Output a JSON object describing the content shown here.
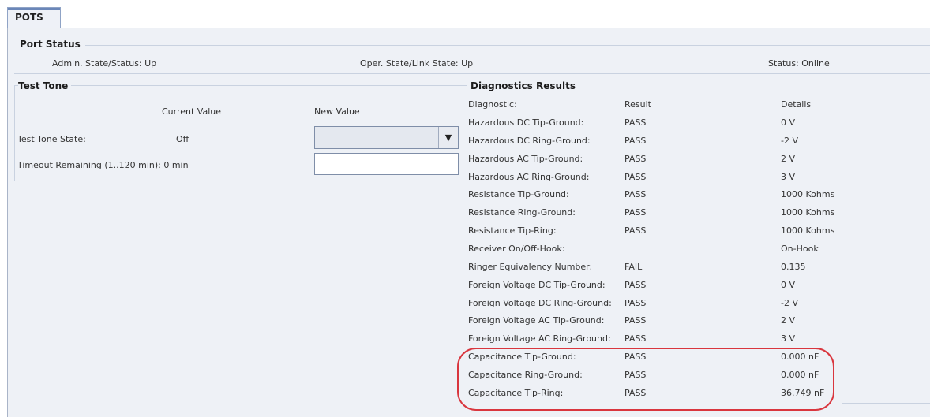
{
  "tab": {
    "label": "POTS"
  },
  "port_status": {
    "title": "Port Status",
    "admin_state": "Admin. State/Status: Up",
    "oper_state": "Oper. State/Link State: Up",
    "status": "Status: Online"
  },
  "test_tone": {
    "title": "Test Tone",
    "current_value_header": "Current Value",
    "new_value_header": "New Value",
    "state_label": "Test Tone State:",
    "state_value": "Off",
    "state_new_value": "",
    "timeout_label": "Timeout Remaining (1..120 min): 0 min",
    "timeout_new_value": ""
  },
  "diagnostics": {
    "title": "Diagnostics Results",
    "headers": {
      "diagnostic": "Diagnostic:",
      "result": "Result",
      "details": "Details"
    },
    "rows": [
      {
        "name": "Hazardous DC Tip-Ground:",
        "result": "PASS",
        "details": "0 V"
      },
      {
        "name": "Hazardous DC Ring-Ground:",
        "result": "PASS",
        "details": "-2 V"
      },
      {
        "name": "Hazardous AC Tip-Ground:",
        "result": "PASS",
        "details": "2 V"
      },
      {
        "name": "Hazardous AC Ring-Ground:",
        "result": "PASS",
        "details": "3 V"
      },
      {
        "name": "Resistance Tip-Ground:",
        "result": "PASS",
        "details": "1000 Kohms"
      },
      {
        "name": "Resistance Ring-Ground:",
        "result": "PASS",
        "details": "1000 Kohms"
      },
      {
        "name": "Resistance Tip-Ring:",
        "result": "PASS",
        "details": "1000 Kohms"
      },
      {
        "name": "Receiver On/Off-Hook:",
        "result": "",
        "details": "On-Hook"
      },
      {
        "name": "Ringer Equivalency Number:",
        "result": "FAIL",
        "details": "0.135"
      },
      {
        "name": "Foreign Voltage DC Tip-Ground:",
        "result": "PASS",
        "details": "0 V"
      },
      {
        "name": "Foreign Voltage DC Ring-Ground:",
        "result": "PASS",
        "details": "-2 V"
      },
      {
        "name": "Foreign Voltage AC Tip-Ground:",
        "result": "PASS",
        "details": "2 V"
      },
      {
        "name": "Foreign Voltage AC Ring-Ground:",
        "result": "PASS",
        "details": "3 V"
      },
      {
        "name": "Capacitance Tip-Ground:",
        "result": "PASS",
        "details": "0.000 nF"
      },
      {
        "name": "Capacitance Ring-Ground:",
        "result": "PASS",
        "details": "0.000 nF"
      },
      {
        "name": "Capacitance Tip-Ring:",
        "result": "PASS",
        "details": "36.749 nF"
      }
    ]
  },
  "colors": {
    "highlight": "#d9363e",
    "panel": "#eef1f6"
  }
}
